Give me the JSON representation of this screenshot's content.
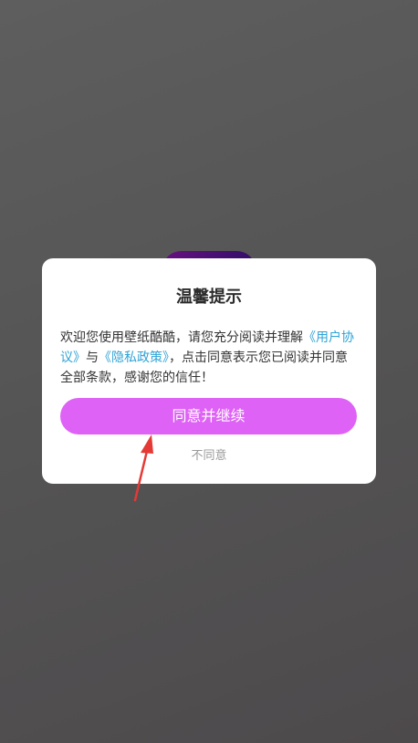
{
  "dialog": {
    "title": "温馨提示",
    "body_prefix": "欢迎您使用壁纸酷酷，请您充分阅读并理解",
    "user_agreement_link": "《用户协议》",
    "conjunction": "与",
    "privacy_policy_link": "《隐私政策》",
    "body_suffix": "，点击同意表示您已阅读并同意全部条款，感谢您的信任！",
    "agree_button_label": "同意并继续",
    "disagree_label": "不同意"
  },
  "colors": {
    "accent_button": "#df62f6",
    "link": "#2fa3d6",
    "annotation_arrow": "#e53935"
  },
  "icons": {
    "app_icon": "app-logo",
    "annotation": "red-arrow-icon"
  }
}
